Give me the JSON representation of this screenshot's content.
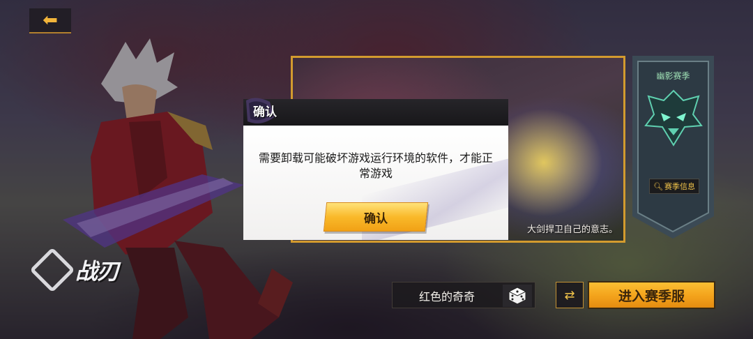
{
  "header": {
    "back_icon": "back-arrow-icon"
  },
  "logo": {
    "text": "战刃",
    "icon": "diamond-logo-icon"
  },
  "video_panel": {
    "caption": "大剑捍卫自己的意志。"
  },
  "season": {
    "title": "幽影赛季",
    "emblem_icon": "shadow-mask-emblem-icon",
    "info_label": "赛季信息",
    "info_icon": "search-icon"
  },
  "bottom": {
    "player_name": "红色的奇奇",
    "dice_icon": "dice-icon",
    "swap_icon": "swap-arrows-icon",
    "swap_glyph": "⇄",
    "enter_label": "进入赛季服"
  },
  "modal": {
    "title": "确认",
    "message": "需要卸载可能破坏游戏运行环境的软件，才能正常游戏",
    "confirm_label": "确认"
  },
  "colors": {
    "accent_gold": "#f3a21b",
    "panel_border": "#d39b2e",
    "season_title": "#9fe0b5"
  }
}
